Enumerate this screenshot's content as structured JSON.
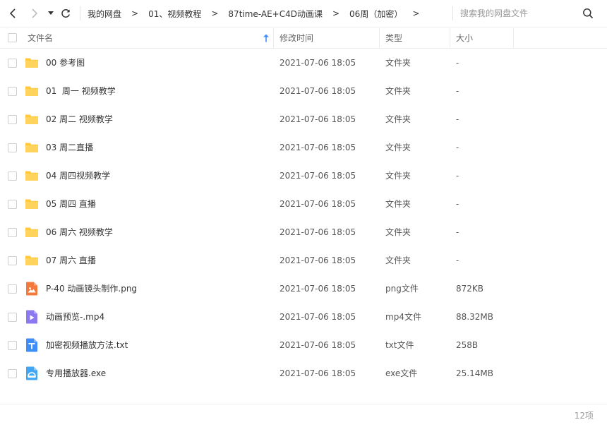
{
  "toolbar": {
    "breadcrumb": [
      "我的网盘",
      "01、视频教程",
      "87time-AE+C4D动画课",
      "06周（加密）"
    ],
    "breadcrumb_separator": ">",
    "search_placeholder": "搜索我的网盘文件"
  },
  "table": {
    "columns": {
      "name": "文件名",
      "mtime": "修改时间",
      "type": "类型",
      "size": "大小"
    },
    "rows": [
      {
        "name": "00 参考图",
        "mtime": "2021-07-06 18:05",
        "type": "文件夹",
        "size": "-",
        "icon": "folder-icon"
      },
      {
        "name": "01  周一 视频教学",
        "mtime": "2021-07-06 18:05",
        "type": "文件夹",
        "size": "-",
        "icon": "folder-icon"
      },
      {
        "name": "02 周二 视频教学",
        "mtime": "2021-07-06 18:05",
        "type": "文件夹",
        "size": "-",
        "icon": "folder-icon"
      },
      {
        "name": "03 周二直播",
        "mtime": "2021-07-06 18:05",
        "type": "文件夹",
        "size": "-",
        "icon": "folder-icon"
      },
      {
        "name": "04 周四视频教学",
        "mtime": "2021-07-06 18:05",
        "type": "文件夹",
        "size": "-",
        "icon": "folder-icon"
      },
      {
        "name": "05 周四 直播",
        "mtime": "2021-07-06 18:05",
        "type": "文件夹",
        "size": "-",
        "icon": "folder-icon"
      },
      {
        "name": "06 周六 视频教学",
        "mtime": "2021-07-06 18:05",
        "type": "文件夹",
        "size": "-",
        "icon": "folder-icon"
      },
      {
        "name": "07 周六 直播",
        "mtime": "2021-07-06 18:05",
        "type": "文件夹",
        "size": "-",
        "icon": "folder-icon"
      },
      {
        "name": "P-40 动画镜头制作.png",
        "mtime": "2021-07-06 18:05",
        "type": "png文件",
        "size": "872KB",
        "icon": "image-file-icon"
      },
      {
        "name": "动画预览-.mp4",
        "mtime": "2021-07-06 18:05",
        "type": "mp4文件",
        "size": "88.32MB",
        "icon": "video-file-icon"
      },
      {
        "name": "加密视频播放方法.txt",
        "mtime": "2021-07-06 18:05",
        "type": "txt文件",
        "size": "258B",
        "icon": "text-file-icon"
      },
      {
        "name": "专用播放器.exe",
        "mtime": "2021-07-06 18:05",
        "type": "exe文件",
        "size": "25.14MB",
        "icon": "exe-file-icon"
      }
    ]
  },
  "footer": {
    "item_count": "12项"
  },
  "colors": {
    "folder": "#FFC83D",
    "image_file": "#F47A3C",
    "video_file": "#8C79F2",
    "text_file": "#3E8EF7",
    "exe_file": "#41A7F5",
    "sort_arrow": "#3E8EF7"
  }
}
